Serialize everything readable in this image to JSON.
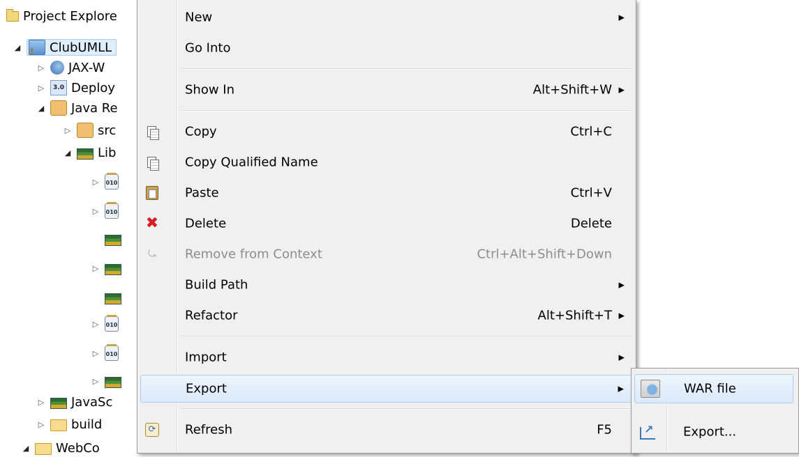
{
  "explorer": {
    "title": "Project Explore",
    "rows": [
      {
        "label": "ClubUMLL",
        "icon": "project-icon",
        "twisty": "◢",
        "indent": 0
      },
      {
        "label": "JAX-W",
        "icon": "web-service-icon",
        "twisty": "▷",
        "indent": 1
      },
      {
        "label": "Deploy",
        "icon": "deployment-descriptor-icon",
        "twisty": "▷",
        "indent": 1,
        "badge": "3.0"
      },
      {
        "label": "Java Re",
        "icon": "java-resources-icon",
        "twisty": "◢",
        "indent": 1
      },
      {
        "label": "src",
        "icon": "source-folder-icon",
        "twisty": "▷",
        "indent": 2
      },
      {
        "label": "Lib",
        "icon": "library-icon",
        "twisty": "◢",
        "indent": 2
      },
      {
        "label": "",
        "icon": "jar-icon",
        "twisty": "▷",
        "indent": 3,
        "badge": "010"
      },
      {
        "label": "",
        "icon": "jar-icon",
        "twisty": "▷",
        "indent": 3,
        "badge": "010"
      },
      {
        "label": "",
        "icon": "library-icon",
        "twisty": "",
        "indent": 3
      },
      {
        "label": "",
        "icon": "library-icon",
        "twisty": "▷",
        "indent": 3
      },
      {
        "label": "",
        "icon": "library-icon",
        "twisty": "",
        "indent": 3
      },
      {
        "label": "",
        "icon": "jar-icon",
        "twisty": "▷",
        "indent": 3,
        "badge": "010"
      },
      {
        "label": "",
        "icon": "jar-icon",
        "twisty": "▷",
        "indent": 3,
        "badge": "010"
      },
      {
        "label": "",
        "icon": "library-icon",
        "twisty": "▷",
        "indent": 3
      },
      {
        "label": "JavaSc",
        "icon": "library-icon",
        "twisty": "▷",
        "indent": 1
      },
      {
        "label": "build",
        "icon": "folder-icon",
        "twisty": "▷",
        "indent": 1
      },
      {
        "label": "WebCo",
        "icon": "folder-icon",
        "twisty": "◢",
        "indent": 1
      }
    ]
  },
  "menu": {
    "items": [
      {
        "id": "new",
        "label": "New",
        "shortcut": "",
        "submenu": true,
        "icon": ""
      },
      {
        "id": "go-into",
        "label": "Go Into",
        "shortcut": "",
        "submenu": false,
        "icon": ""
      },
      {
        "id": "show-in",
        "label": "Show In",
        "shortcut": "Alt+Shift+W",
        "submenu": true,
        "icon": ""
      },
      {
        "id": "copy",
        "label": "Copy",
        "shortcut": "Ctrl+C",
        "submenu": false,
        "icon": "copy-icon"
      },
      {
        "id": "copy-qualified-name",
        "label": "Copy Qualified Name",
        "shortcut": "",
        "submenu": false,
        "icon": "copy-qualified-name-icon"
      },
      {
        "id": "paste",
        "label": "Paste",
        "shortcut": "Ctrl+V",
        "submenu": false,
        "icon": "paste-icon"
      },
      {
        "id": "delete",
        "label": "Delete",
        "shortcut": "Delete",
        "submenu": false,
        "icon": "delete-icon"
      },
      {
        "id": "remove-from-context",
        "label": "Remove from Context",
        "shortcut": "Ctrl+Alt+Shift+Down",
        "submenu": false,
        "icon": "remove-from-context-icon",
        "disabled": true
      },
      {
        "id": "build-path",
        "label": "Build Path",
        "shortcut": "",
        "submenu": true,
        "icon": ""
      },
      {
        "id": "refactor",
        "label": "Refactor",
        "shortcut": "Alt+Shift+T",
        "submenu": true,
        "icon": ""
      },
      {
        "id": "import",
        "label": "Import",
        "shortcut": "",
        "submenu": true,
        "icon": ""
      },
      {
        "id": "export",
        "label": "Export",
        "shortcut": "",
        "submenu": true,
        "icon": "",
        "highlighted": true
      },
      {
        "id": "refresh",
        "label": "Refresh",
        "shortcut": "F5",
        "submenu": false,
        "icon": "refresh-icon"
      }
    ]
  },
  "submenu": {
    "items": [
      {
        "id": "war-file",
        "label": "WAR file",
        "icon": "war-file-icon",
        "highlighted": true
      },
      {
        "id": "export-wizard",
        "label": "Export...",
        "icon": "export-icon"
      }
    ]
  },
  "glyphs": {
    "submenu_arrow": "▶"
  }
}
